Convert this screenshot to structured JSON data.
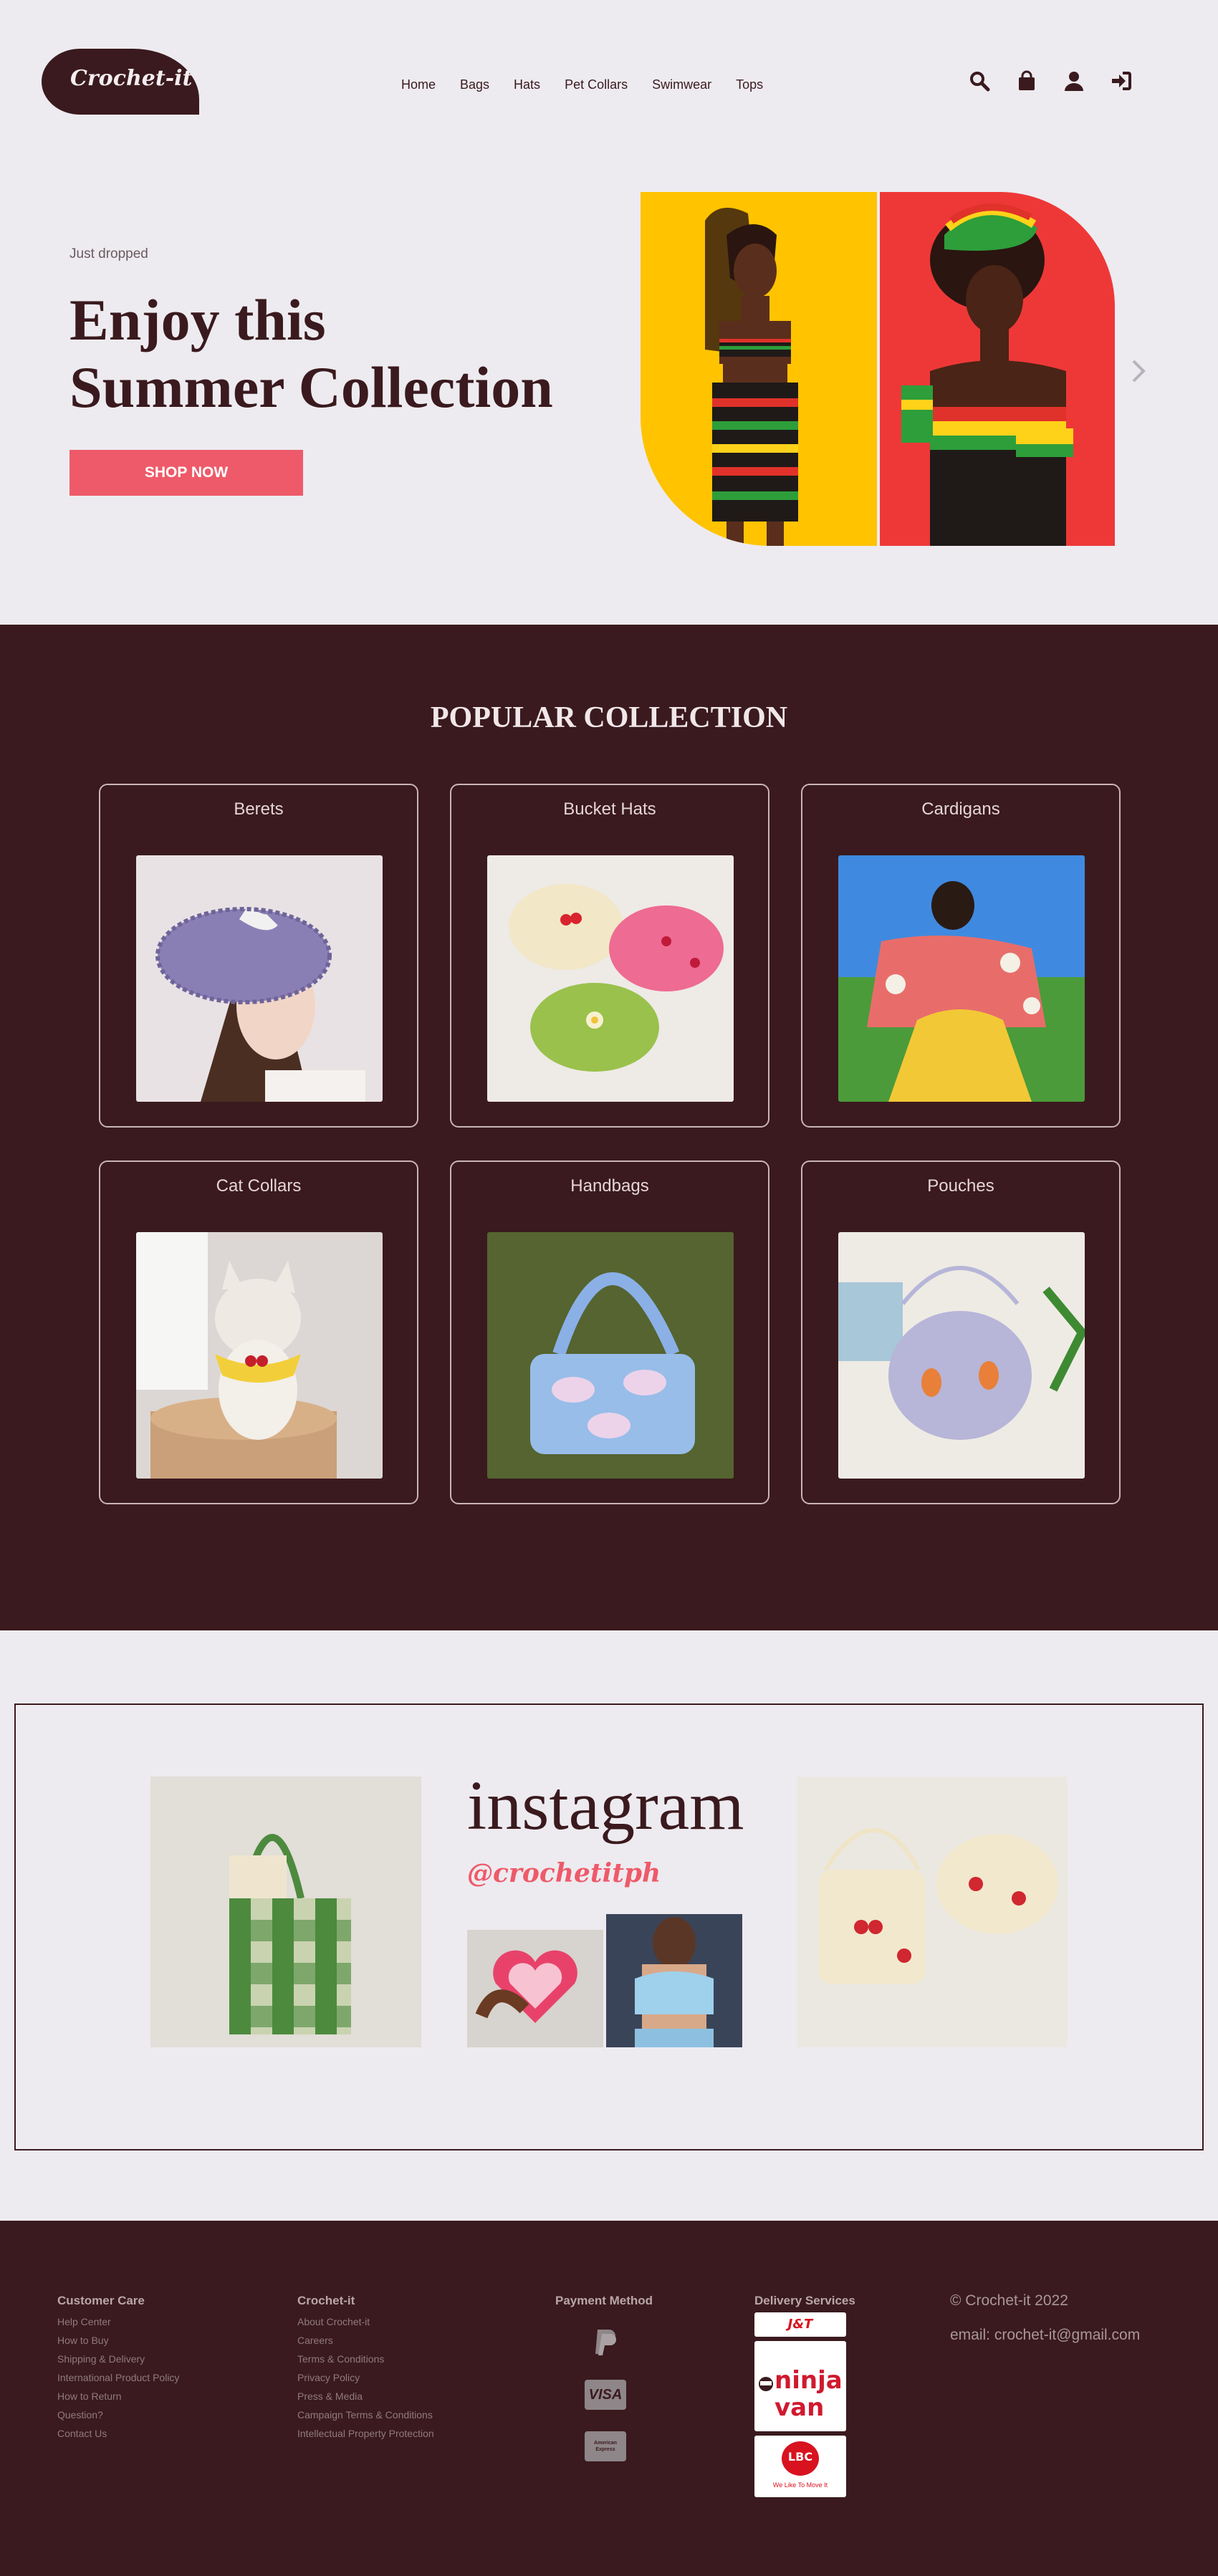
{
  "brand": {
    "logo_text": "Crochet-it"
  },
  "nav": [
    "Home",
    "Bags",
    "Hats",
    "Pet Collars",
    "Swimwear",
    "Tops"
  ],
  "header_icons": [
    "search-icon",
    "shopping-bag-icon",
    "user-icon",
    "sign-in-icon"
  ],
  "hero": {
    "subtitle": "Just dropped",
    "title_line1": "Enjoy this",
    "title_line2": "Summer Collection",
    "button": "SHOP NOW"
  },
  "popular": {
    "title": "POPULAR COLLECTION",
    "items": [
      {
        "label": "Berets"
      },
      {
        "label": "Bucket Hats"
      },
      {
        "label": "Cardigans"
      },
      {
        "label": "Cat Collars"
      },
      {
        "label": "Handbags"
      },
      {
        "label": "Pouches"
      }
    ]
  },
  "instagram": {
    "title": "instagram",
    "handle": "@crochetitph"
  },
  "footer": {
    "customer_care": {
      "heading": "Customer Care",
      "links": [
        "Help Center",
        "How to Buy",
        "Shipping & Delivery",
        "International Product Policy",
        "How to Return",
        "Question?",
        "Contact Us"
      ]
    },
    "crochet_it": {
      "heading": "Crochet-it",
      "links": [
        "About Crochet-it",
        "Careers",
        "Terms & Conditions",
        "Privacy Policy",
        "Press & Media",
        "Campaign Terms & Conditions",
        "Intellectual Property Protection"
      ]
    },
    "payment": {
      "heading": "Payment Method",
      "methods": [
        "PayPal",
        "VISA",
        "American Express"
      ]
    },
    "delivery": {
      "heading": "Delivery Services",
      "services": [
        "J&T EXPRESS",
        "ninja van",
        "LBC",
        "We Like To Move It"
      ]
    },
    "copyright": "© Crochet-it 2022",
    "email": "email: crochet-it@gmail.com"
  },
  "colors": {
    "primary": "#3a1a1e",
    "accent": "#ee5a69",
    "background": "#edebf0"
  }
}
